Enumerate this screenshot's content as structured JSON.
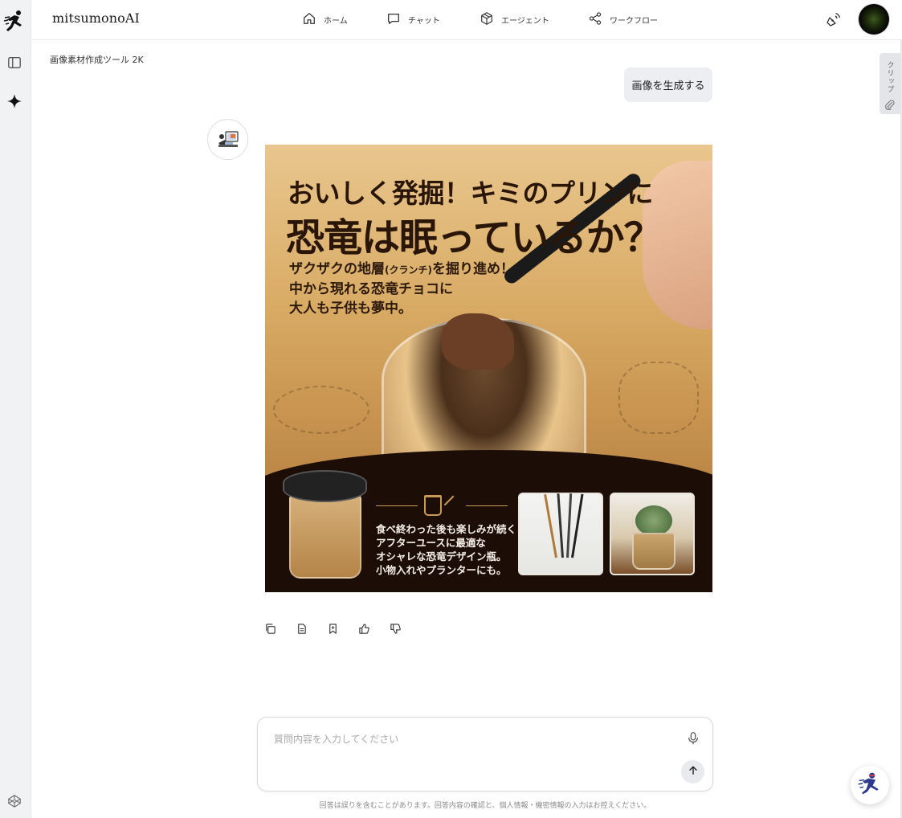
{
  "app": {
    "brand": "mitsumonoAI"
  },
  "nav": {
    "items": [
      {
        "label": "ホーム",
        "icon": "home-icon"
      },
      {
        "label": "チャット",
        "icon": "chat-icon"
      },
      {
        "label": "エージェント",
        "icon": "agent-cube-icon"
      },
      {
        "label": "ワークフロー",
        "icon": "workflow-share-icon"
      }
    ]
  },
  "page": {
    "title": "画像素材作成ツール 2K"
  },
  "clip": {
    "label": "クリップ"
  },
  "conversation": {
    "user_message": "画像を生成する",
    "generated_image": {
      "headline_line1": "おいしく発掘！キミのプリンに",
      "headline_line2": "恐竜は眠っているか？",
      "sub_line1_a": "ザクザクの地層",
      "sub_line1_small": "(クランチ)",
      "sub_line1_b": "を掘り進め！",
      "sub_line2": "中から現れる恐竜チョコに",
      "sub_line3": "大人も子供も夢中。",
      "info_line1": "食べ終わった後も楽しみが続く：",
      "info_line2": "アフターユースに最適な",
      "info_line3": "オシャレな恐竜デザイン瓶。",
      "info_line4": "小物入れやプランターにも。"
    }
  },
  "composer": {
    "placeholder": "質問内容を入力してください",
    "disclaimer": "回答は誤りを含むことがあります。回答内容の確認と、個人情報・機密情報の入力はお控えください。"
  },
  "colors": {
    "accent": "#1a1a1a",
    "rail_bg": "#f1f2f4",
    "bubble_bg": "#eceef2"
  }
}
